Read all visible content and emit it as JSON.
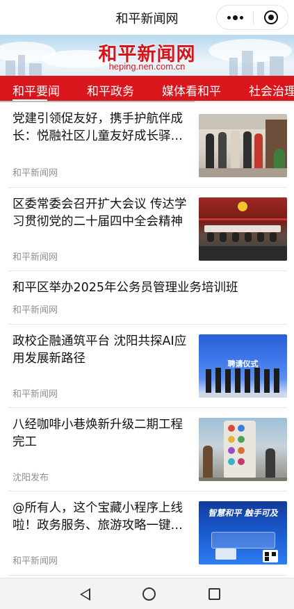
{
  "app": {
    "title": "和平新闻网"
  },
  "banner": {
    "brand": "和平新闻网",
    "domain": "heping.nen.com.cn"
  },
  "tabs": [
    {
      "label": "和平要闻",
      "active": true
    },
    {
      "label": "和平政务",
      "active": false
    },
    {
      "label": "媒体看和平",
      "active": false
    },
    {
      "label": "社会治理",
      "active": false
    }
  ],
  "news": [
    {
      "headline": "党建引领促友好，携手护航伴成长：悦融社区儿童友好成长驿站揭牌",
      "source": "和平新闻网",
      "thumb_icon": "photo-community-event"
    },
    {
      "headline": "区委常委会召开扩大会议  传达学习贯彻党的二十届四中全会精神",
      "source": "和平新闻网",
      "thumb_icon": "photo-meeting"
    },
    {
      "headline": "和平区举办2025年公务员管理业务培训班",
      "source": "和平新闻网",
      "thumb_icon": ""
    },
    {
      "headline": "政校企融通筑平台 沈阳共探AI应用发展新路径",
      "source": "和平新闻网",
      "thumb_icon": "photo-ceremony",
      "thumb_text": "聘请仪式"
    },
    {
      "headline": "八经咖啡小巷焕新升级二期工程完工",
      "source": "沈阳发布",
      "thumb_icon": "photo-street-art"
    },
    {
      "headline": "@所有人，这个宝藏小程序上线啦！政务服务、旅游攻略一键获取",
      "source": "和平新闻网",
      "thumb_icon": "photo-poster",
      "thumb_text": "智慧和平 触手可及"
    }
  ],
  "colors": {
    "brand_red": "#d8161b",
    "source_gray": "#8f8f8f"
  },
  "system_nav": {
    "back": "back-triangle-icon",
    "home": "home-circle-icon",
    "recents": "recents-square-icon"
  }
}
